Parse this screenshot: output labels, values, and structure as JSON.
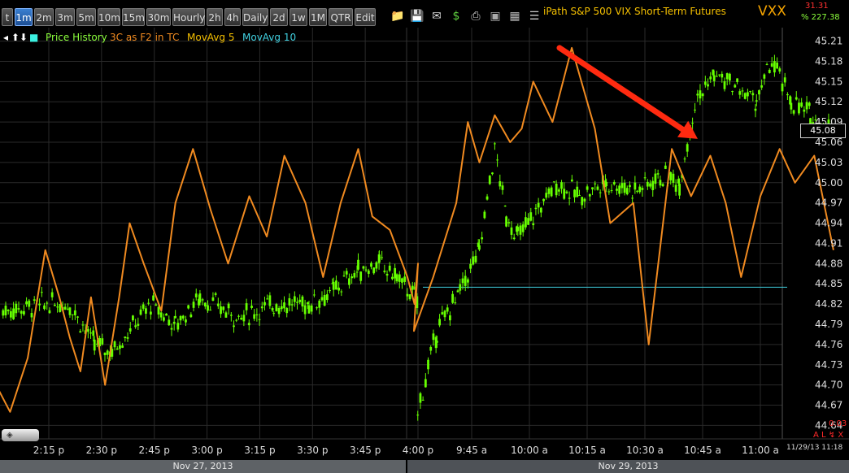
{
  "toolbar": {
    "buttons": [
      "t",
      "1m",
      "2m",
      "3m",
      "5m",
      "10m",
      "15m",
      "30m",
      "Hourly",
      "2h",
      "4h",
      "Daily",
      "2d",
      "1w",
      "1M",
      "QTR",
      "Edit"
    ],
    "active": "1m",
    "icons": [
      "folder-icon",
      "save-icon",
      "email-icon",
      "dollar-icon",
      "print-icon",
      "monitor-icon",
      "grid-icon",
      "lines-icon"
    ]
  },
  "header": {
    "title": "iPath S&P 500 VIX Short-Term Futures",
    "ticker": "VXX",
    "quote_change": "31.31",
    "quote_pct": "% 227.38"
  },
  "legend": {
    "price_history": "Price History",
    "threec": "3C as F2 in TC",
    "movavg5": "MovAvg 5",
    "movavg10": "MovAvg 10"
  },
  "colors": {
    "background": "#000000",
    "price_up": "#66ff00",
    "threec_line": "#f08a20",
    "movavg5": "#f5c000",
    "movavg10": "#40d0e0",
    "arrow": "#ff2a10",
    "grid": "#2a2a2a"
  },
  "axis": {
    "y_ticks": [
      "45.21",
      "45.18",
      "45.15",
      "45.12",
      "45.09",
      "45.06",
      "45.03",
      "45.00",
      "44.97",
      "44.94",
      "44.91",
      "44.88",
      "44.85",
      "44.82",
      "44.79",
      "44.76",
      "44.73",
      "44.70",
      "44.67",
      "44.64"
    ],
    "x_ticks": [
      "2:15 p",
      "2:30 p",
      "2:45 p",
      "3:00 p",
      "3:15 p",
      "3:30 p",
      "3:45 p",
      "4:00 p",
      "9:45 a",
      "10:00 a",
      "10:15 a",
      "10:30 a",
      "10:45 a",
      "11:00 a"
    ],
    "current_price": "45.08",
    "change": "0.03",
    "timestamp": "11/29/13 11:18",
    "sub_icons": "A L ↯ X"
  },
  "dates": [
    "Nov 27, 2013",
    "Nov 29, 2013"
  ],
  "chart_data": {
    "type": "line",
    "symbol": "VXX",
    "timeframe": "1m",
    "ylim": [
      44.62,
      45.23
    ],
    "x_labels": [
      "2:15 p",
      "2:30 p",
      "2:45 p",
      "3:00 p",
      "3:15 p",
      "3:30 p",
      "3:45 p",
      "4:00 p",
      "9:45 a",
      "10:00 a",
      "10:15 a",
      "10:30 a",
      "10:45 a",
      "11:00 a"
    ],
    "price_series": {
      "name": "Price History",
      "x": [
        "2:02 p",
        "2:13 p",
        "2:21 p",
        "2:28 p",
        "2:33 p",
        "2:44 p",
        "2:51 p",
        "2:58 p",
        "3:09 p",
        "3:19 p",
        "3:29 p",
        "3:36 p",
        "3:43 p",
        "3:49 p",
        "3:54 p",
        "3:59 p",
        "4:00 p",
        "9:31 a",
        "9:36 a",
        "9:42 a",
        "9:47 a",
        "9:51 a",
        "9:54 a",
        "9:57 a",
        "10:01 a",
        "10:07 a",
        "10:13 a",
        "10:20 a",
        "10:28 a",
        "10:34 a",
        "10:39 a",
        "10:43 a",
        "10:48 a",
        "10:54 a",
        "10:59 a",
        "11:03 a",
        "11:08 a",
        "11:13 a",
        "11:18 a"
      ],
      "y": [
        44.81,
        44.82,
        44.82,
        44.76,
        44.75,
        44.82,
        44.79,
        44.83,
        44.8,
        44.82,
        44.82,
        44.84,
        44.87,
        44.88,
        44.86,
        44.83,
        44.82,
        44.66,
        44.78,
        44.84,
        44.9,
        45.05,
        44.95,
        44.92,
        44.95,
        45.0,
        44.98,
        45.0,
        44.99,
        45.01,
        45.0,
        45.12,
        45.16,
        45.14,
        45.12,
        45.18,
        45.12,
        45.1,
        45.08
      ]
    },
    "threec_series": {
      "name": "3C as F2 in TC",
      "x": [
        "2:00 p",
        "2:04 p",
        "2:09 p",
        "2:14 p",
        "2:18 p",
        "2:21 p",
        "2:24 p",
        "2:27 p",
        "2:31 p",
        "2:35 p",
        "2:38 p",
        "2:42 p",
        "2:47 p",
        "2:51 p",
        "2:56 p",
        "3:01 p",
        "3:06 p",
        "3:12 p",
        "3:17 p",
        "3:22 p",
        "3:28 p",
        "3:33 p",
        "3:38 p",
        "3:43 p",
        "3:47 p",
        "3:52 p",
        "3:57 p",
        "3:59 p",
        "4:00 p",
        "9:30 a",
        "9:35 a",
        "9:41 a",
        "9:44 a",
        "9:47 a",
        "9:51 a",
        "9:55 a",
        "9:58 a",
        "10:01 a",
        "10:06 a",
        "10:11 a",
        "10:17 a",
        "10:21 a",
        "10:27 a",
        "10:31 a",
        "10:37 a",
        "10:42 a",
        "10:47 a",
        "10:51 a",
        "10:55 a",
        "11:00 a",
        "11:05 a",
        "11:09 a",
        "11:14 a",
        "11:19 a"
      ],
      "y": [
        44.7,
        44.66,
        44.74,
        44.9,
        44.83,
        44.77,
        44.72,
        44.83,
        44.7,
        44.83,
        44.94,
        44.88,
        44.81,
        44.97,
        45.05,
        44.96,
        44.88,
        44.98,
        44.92,
        45.04,
        44.97,
        44.86,
        44.97,
        45.05,
        44.95,
        44.93,
        44.86,
        44.82,
        44.88,
        44.78,
        44.86,
        44.97,
        45.09,
        45.03,
        45.1,
        45.06,
        45.08,
        45.15,
        45.09,
        45.2,
        45.08,
        44.94,
        44.97,
        44.76,
        45.05,
        44.98,
        45.04,
        44.97,
        44.86,
        44.98,
        45.05,
        45.0,
        45.04,
        44.9
      ]
    },
    "annotations": [
      {
        "type": "arrow",
        "label": "down-trend arrow"
      }
    ]
  }
}
